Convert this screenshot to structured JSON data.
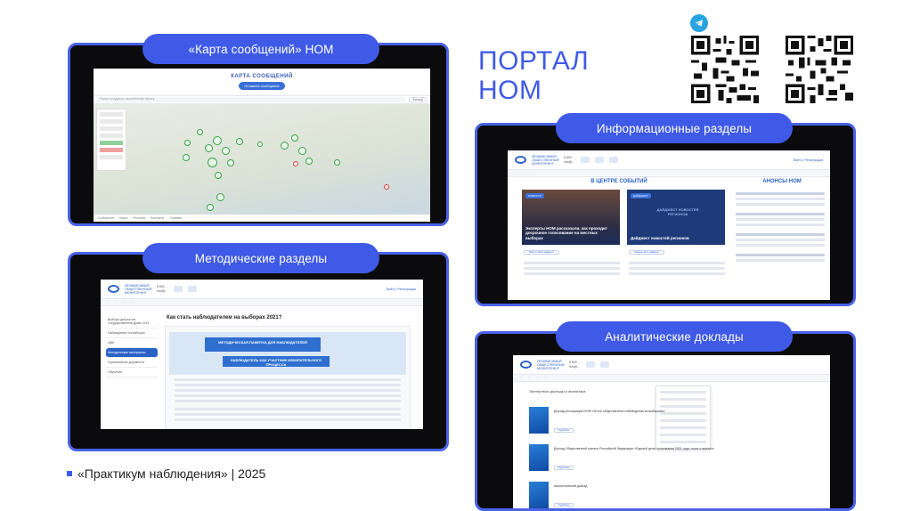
{
  "title": {
    "line1": "ПОРТАЛ",
    "line2": "НОМ"
  },
  "footer": {
    "text": "«Практикум наблюдения» | 2025"
  },
  "panels": {
    "map": {
      "label": "«Карта сообщений» НОМ",
      "page_title": "КАРТА СООБЩЕНИЙ",
      "button": "Оставить сообщение",
      "search_placeholder": "Поиск по адресу, населённому пункту",
      "filter_btn": "Фильтр",
      "footer_links": [
        "Сообщения",
        "Карта",
        "Регионы",
        "Контакты",
        "Справка"
      ]
    },
    "info": {
      "label": "Информационные разделы",
      "logo": "НЕЗАВИСИМЫЙ ОБЩЕСТВЕННЫЙ МОНИТОРИНГ",
      "center_title": "В ЦЕНТРЕ СОБЫТИЙ",
      "announce_title": "АНОНСЫ НОМ",
      "login": "Войти / Регистрация",
      "card1_tag": "НОВОСТИ",
      "card1": "Эксперты НОМ рассказали, как проходит досрочное голосование на местных выборах",
      "card2_tag": "ДАЙДЖЕСТ",
      "card2_banner": "ДАЙДЖЕСТ НОВОСТЕЙ РЕГИОНОВ",
      "card2": "Дайджест новостей регионов",
      "more1": "Новости фото-дайджест",
      "more2": "Главные фото-дайджест"
    },
    "method": {
      "label": "Методические разделы",
      "page_title": "Как стать наблюдателем на выборах 2021?",
      "banner1": "МЕТОДИЧЕСКАЯ ПАМЯТКА ДЛЯ НАБЛЮДАТЕЛЕЙ",
      "banner2": "НАБЛЮДАТЕЛЬ КАК УЧАСТНИК ИЗБИРАТЕЛЬНОГО ПРОЦЕССА",
      "side_items": [
        "Выборы депутатов Государственной Думы 2021",
        "Наблюдатель на выборах",
        "ЦИК",
        "Методические материалы",
        "Нормативные документы",
        "Обучение"
      ]
    },
    "reports": {
      "label": "Аналитические доклады",
      "section": "Экспертные доклады и аналитика",
      "items": [
        "Доклад Ассоциации НОМ «Итоги общественного наблюдения за выборами»",
        "Доклад Общественной палаты Российской Федерации «Единый день голосования 2021 года: итоги и анализ»",
        "Аналитический доклад"
      ],
      "more": "Подробнее"
    }
  },
  "colors": {
    "accent": "#3f5ae6",
    "frame": "#0b0b0d",
    "site_blue": "#2b62c8"
  },
  "icons": {
    "telegram": "telegram-icon",
    "qr1": "qr-code-icon",
    "qr2": "qr-code-icon"
  }
}
